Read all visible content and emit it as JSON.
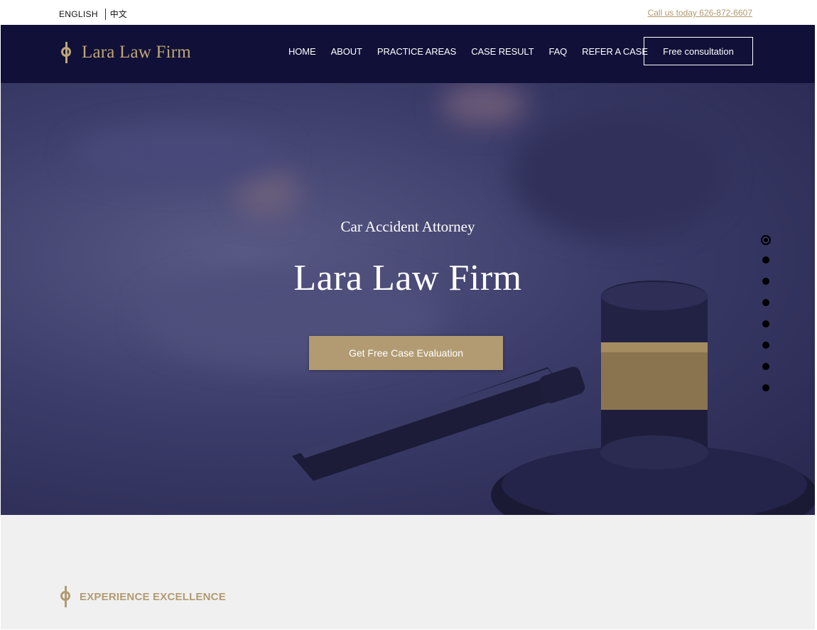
{
  "topbar": {
    "lang_english": "ENGLISH",
    "lang_chinese": "中文",
    "call_text": "Call us today 626-872-6607"
  },
  "header": {
    "logo_text": "Lara Law Firm",
    "nav": [
      "HOME",
      "ABOUT",
      "PRACTICE AREAS",
      "CASE RESULT",
      "FAQ",
      "REFER A CASE"
    ],
    "cta_label": "Free consultation"
  },
  "hero": {
    "subtitle": "Car Accident Attorney",
    "title": "Lara Law Firm",
    "cta_label": "Get Free Case Evaluation",
    "slide_count": 8,
    "active_slide": 1
  },
  "section": {
    "heading": "EXPERIENCE EXCELLENCE"
  },
  "colors": {
    "navy": "#101038",
    "gold": "#b29b72",
    "hero_overlay": "#3c3c6a",
    "section_bg": "#f0f0f0"
  },
  "icons": {
    "logo": "phi-logo-icon",
    "section": "phi-section-icon"
  }
}
